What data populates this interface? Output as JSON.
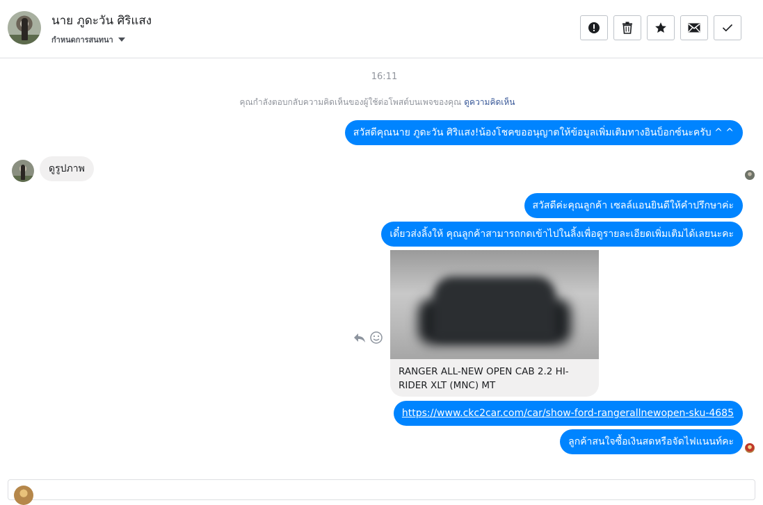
{
  "header": {
    "name": "นาย ภูดะวัน ศิริแสง",
    "subtitle": "กำหนดการสนทนา",
    "actions": [
      {
        "icon": "alert-icon",
        "label": ""
      },
      {
        "icon": "trash-icon",
        "label": ""
      },
      {
        "icon": "star-icon",
        "label": ""
      },
      {
        "icon": "envelope-icon",
        "label": ""
      },
      {
        "icon": "check-icon",
        "label": ""
      }
    ]
  },
  "thread": {
    "time": "16:11",
    "notice_text": "คุณกำลังตอบกลับความคิดเห็นของผู้ใช้ต่อโพสต์บนเพจของคุณ",
    "notice_link": "ดูความคิดเห็น",
    "messages": [
      {
        "dir": "out",
        "text": "สวัสดีคุณนาย ภูดะวัน ศิริแสง!น้องโชคขออนุญาตให้ข้อมูลเพิ่มเติมทางอินบ็อกซ์นะครับ ^ ^"
      },
      {
        "dir": "in",
        "text": "ดูรูปภาพ"
      },
      {
        "dir": "out",
        "text": "สวัสดีค่ะคุณลูกค้า เซลล์แอนยินดีให้คำปรึกษาค่ะ"
      },
      {
        "dir": "out",
        "text": "เดี๋ยวส่งลิ้งให้ คุณลูกค้าสามารถกดเข้าไปในลิ้งเพื่อดูรายละเอียดเพิ่มเติมได้เลยนะคะ"
      },
      {
        "dir": "out",
        "type": "card",
        "title": "RANGER ALL-NEW OPEN CAB 2.2 HI-RIDER XLT (MNC) MT"
      },
      {
        "dir": "out",
        "type": "link",
        "text": "https://www.ckc2car.com/car/show-ford-rangerallnewopen-sku-4685"
      },
      {
        "dir": "out",
        "text": "ลูกค้าสนใจซื้อเงินสดหรือจัดไฟแนนท์คะ"
      }
    ]
  },
  "composer": {
    "placeholder": ""
  },
  "colors": {
    "accent": "#0084ff",
    "incoming": "#f1f0f0",
    "link": "#385898",
    "muted": "#90949c"
  }
}
